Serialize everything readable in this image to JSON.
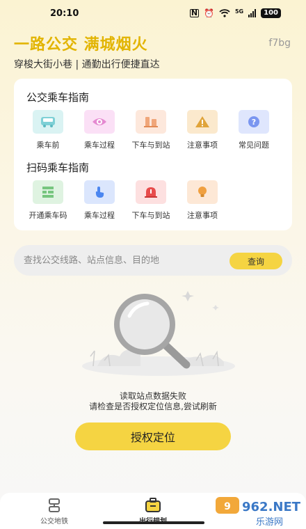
{
  "status_bar": {
    "time": "20:10",
    "network": "5G",
    "battery": "100"
  },
  "header": {
    "title": "一路公交 满城烟火",
    "subtitle": "穿梭大街小巷 | 通勤出行便捷直达",
    "corner_code": "f7bg"
  },
  "bus_guide": {
    "title": "公交乘车指南",
    "items": [
      {
        "label": "乘车前",
        "icon": "bus-icon",
        "color": "#7ed0d6"
      },
      {
        "label": "乘车过程",
        "icon": "eye-icon",
        "color": "#e58ad1"
      },
      {
        "label": "下车与到站",
        "icon": "arrival-icon",
        "color": "#f0a67a"
      },
      {
        "label": "注意事项",
        "icon": "warning-icon",
        "color": "#e0a43a"
      },
      {
        "label": "常见问题",
        "icon": "question-icon",
        "color": "#7a96f0"
      }
    ]
  },
  "scan_guide": {
    "title": "扫码乘车指南",
    "items": [
      {
        "label": "开通乘车码",
        "icon": "qr-code-icon",
        "color": "#76c57e"
      },
      {
        "label": "乘车过程",
        "icon": "tap-icon",
        "color": "#4b86f0"
      },
      {
        "label": "下车与到站",
        "icon": "siren-icon",
        "color": "#e84c4c"
      },
      {
        "label": "注意事项",
        "icon": "lightbulb-icon",
        "color": "#f0a040"
      }
    ]
  },
  "search": {
    "placeholder": "查找公交线路、站点信息、目的地",
    "button": "查询"
  },
  "empty_state": {
    "line1": "读取站点数据失败",
    "line2": "请检查是否授权定位信息,尝试刷新",
    "button": "授权定位"
  },
  "bottom_nav": {
    "items": [
      {
        "label": "公交地铁",
        "icon": "transit-icon"
      },
      {
        "label": "出行规划",
        "icon": "planner-icon"
      }
    ]
  },
  "watermark": {
    "text": "962.NET",
    "sub": "乐游网"
  },
  "colors": {
    "accent": "#f5d442",
    "title": "#e2b400"
  }
}
